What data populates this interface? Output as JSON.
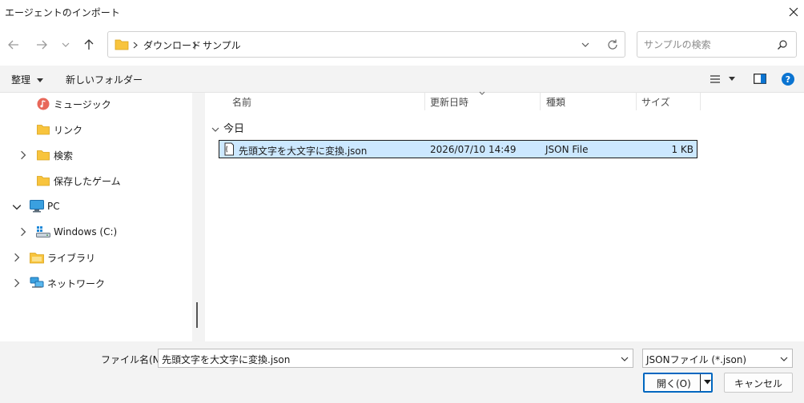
{
  "window": {
    "title": "エージェントのインポート"
  },
  "address": {
    "crumbs": [
      "ダウンロード",
      "サンプル"
    ]
  },
  "search": {
    "placeholder": "サンプルの検索"
  },
  "toolbar": {
    "organize_label": "整理",
    "new_folder_label": "新しいフォルダー"
  },
  "sidebar": {
    "items": [
      {
        "label": "ミュージック"
      },
      {
        "label": "リンク"
      },
      {
        "label": "検索"
      },
      {
        "label": "保存したゲーム"
      },
      {
        "label": "PC"
      },
      {
        "label": "Windows (C:)"
      },
      {
        "label": "ライブラリ"
      },
      {
        "label": "ネットワーク"
      }
    ]
  },
  "file_list": {
    "columns": [
      "名前",
      "更新日時",
      "種類",
      "サイズ"
    ],
    "group_label": "今日",
    "files": [
      {
        "name": "先頭文字を大文字に変換.json",
        "modified": "2026/07/10 14:49",
        "type": "JSON File",
        "size": "1 KB"
      }
    ]
  },
  "footer": {
    "filename_label": "ファイル名(N):",
    "filename_value": "先頭文字を大文字に変換.json",
    "filetype_value": "JSONファイル (*.json)",
    "open_label": "開く(O)",
    "cancel_label": "キャンセル"
  },
  "colors": {
    "accent": "#0067c0",
    "selection": "#cce8ff",
    "folder": "#f8c43d",
    "help": "#0b74d1"
  }
}
